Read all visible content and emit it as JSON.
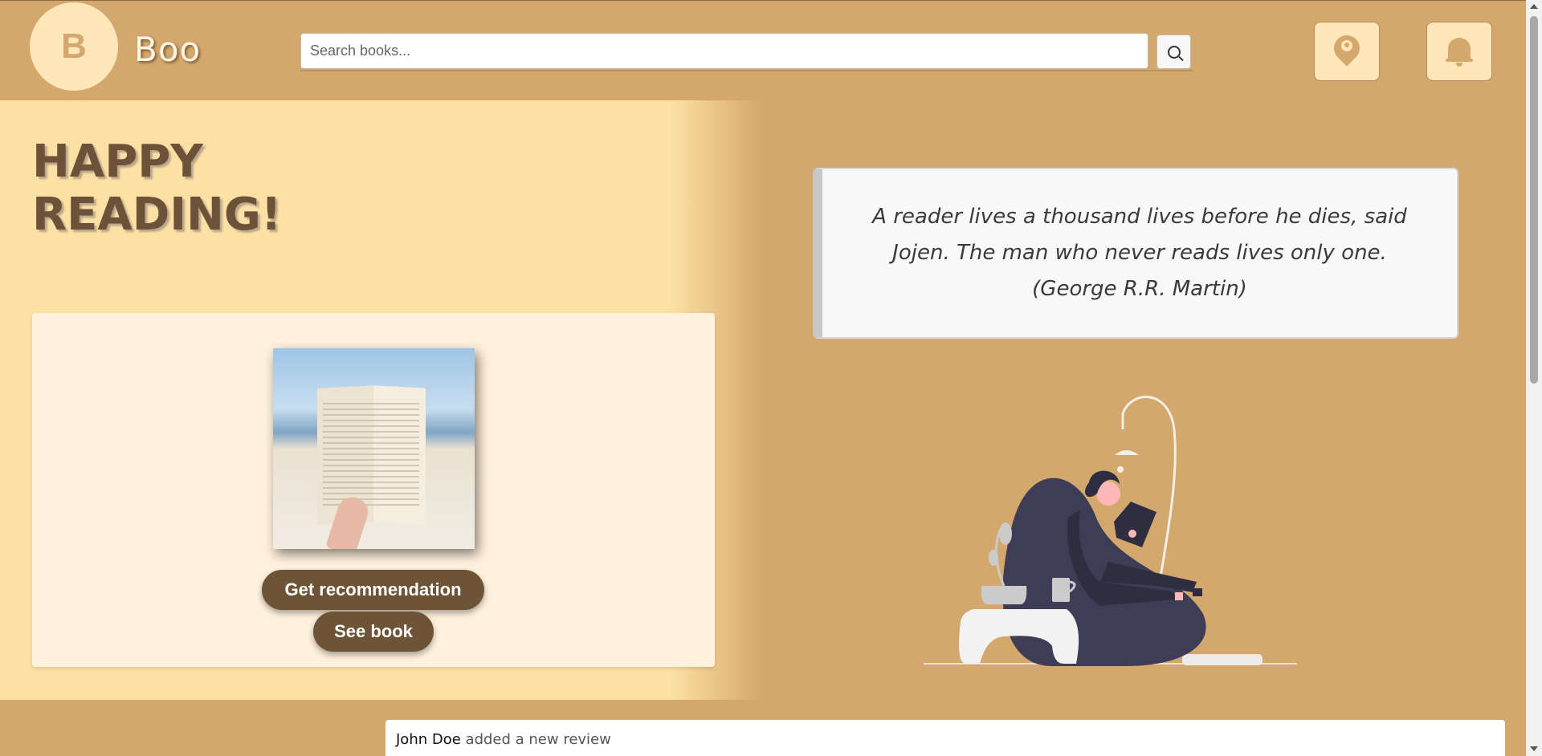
{
  "header": {
    "logo_letter": "B",
    "brand": "Boo",
    "search_placeholder": "Search books...",
    "search_value": "",
    "location_icon": "map-pin-user-icon",
    "notification_icon": "bell-icon"
  },
  "hero": {
    "title": "HAPPY READING!",
    "recommendation": {
      "image_subject": "open-book-on-beach",
      "get_recommendation_label": "Get recommendation",
      "see_book_label": "See book"
    },
    "quote": "A reader lives a thousand lives before he dies, said Jojen. The man who never reads lives only one. (George R.R. Martin)",
    "illustration": "woman-reading-on-beanbag"
  },
  "feed": {
    "items": [
      {
        "user": "John Doe",
        "action": "added a new review"
      }
    ]
  },
  "colors": {
    "page_background": "#d4a76c",
    "hero_panel": "#fde0a3",
    "card": "#fff2dc",
    "button": "#6e5436",
    "title_text": "#6b5238"
  }
}
